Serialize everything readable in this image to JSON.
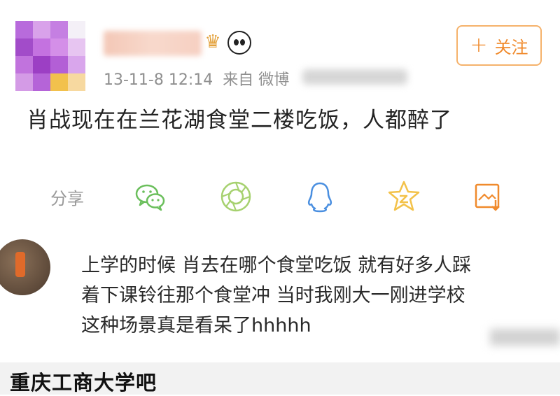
{
  "post": {
    "timestamp": "13-11-8 12:14",
    "source_prefix": "来自 微博",
    "follow_label": "关注",
    "text": "肖战现在在兰花湖食堂二楼吃饭，人都醉了",
    "share_label": "分享",
    "share_icons": [
      "wechat-icon",
      "moments-icon",
      "qq-icon",
      "qzone-icon",
      "save-image-icon"
    ]
  },
  "comment": {
    "lines": [
      "上学的时候  肖去在哪个食堂吃饭  就有好多人踩",
      "着下课铃往那个食堂冲  当时我刚大一刚进学校",
      "这种场景真是看呆了hhhhh"
    ]
  },
  "footer": {
    "caption": "重庆工商大学吧"
  },
  "colors": {
    "accent_orange": "#f08a2c",
    "share_green": "#6bbf5c",
    "share_blue": "#4a8fe0",
    "share_yellow": "#f3c24a"
  }
}
